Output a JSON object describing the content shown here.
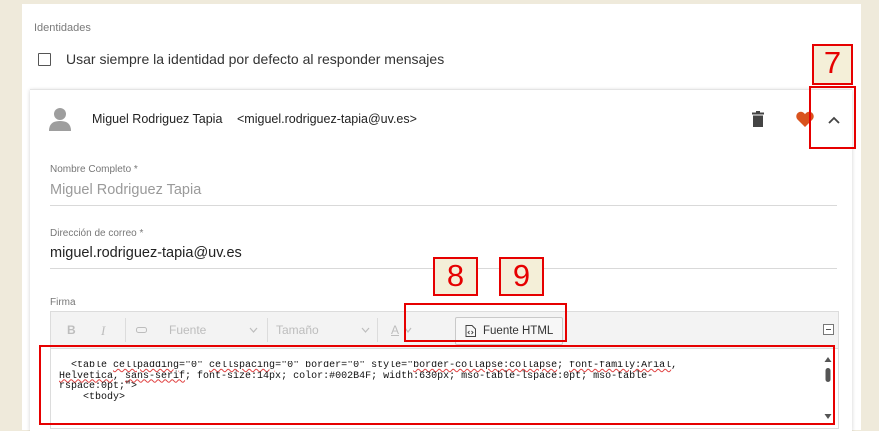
{
  "section": {
    "title": "Identidades",
    "default_identity_label": "Usar siempre la identidad por defecto al responder mensajes",
    "default_identity_checked": false
  },
  "identity": {
    "name": "Miguel Rodriguez Tapia",
    "email": "<miguel.rodriguez-tapia@uv.es>",
    "fields": {
      "full_name_label": "Nombre Completo *",
      "full_name_value": "Miguel Rodriguez Tapia",
      "email_label": "Dirección de correo *",
      "email_value": "miguel.rodriguez-tapia@uv.es",
      "signature_label": "Firma"
    },
    "icons": [
      "user-avatar-icon",
      "trash-icon",
      "heart-icon",
      "chevron-up-icon"
    ]
  },
  "toolbar": {
    "bold": "B",
    "italic": "I",
    "font_label": "Fuente",
    "size_label": "Tamaño",
    "color_label": "A",
    "source_label": "Fuente HTML"
  },
  "editor": {
    "code_lines": [
      "  <table cellpadding=\"0\" cellspacing=\"0\" border=\"0\" style=\"border-collapse:collapse; font-family:Arial,",
      "Helvetica, sans-serif; font-size:14px; color:#002B4F; width:630px; mso-table-lspace:0pt; mso-table-",
      "rspace:0pt;\">",
      "    <tbody>"
    ]
  },
  "callouts": [
    "7",
    "8",
    "9"
  ],
  "colors": {
    "callout": "#e60000",
    "heart": "#d9531e",
    "background": "#efeadb"
  }
}
